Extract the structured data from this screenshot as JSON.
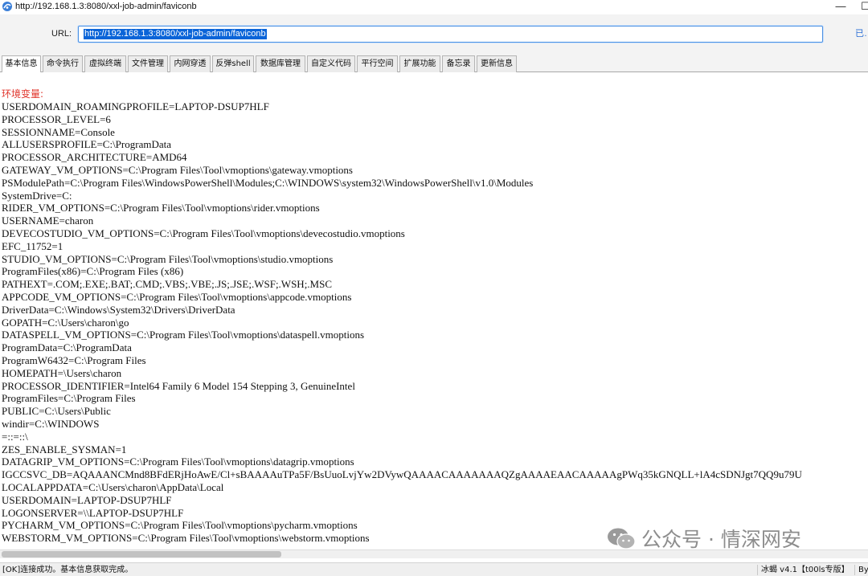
{
  "window": {
    "title": "http://192.168.1.3:8080/xxl-job-admin/faviconb",
    "minimize_glyph": "—",
    "maximize_glyph": "☐"
  },
  "urlbar": {
    "label": "URL:",
    "value": "http://192.168.1.3:8080/xxl-job-admin/faviconb",
    "right_text": "已…"
  },
  "tabs": [
    {
      "label": "基本信息",
      "active": true
    },
    {
      "label": "命令执行"
    },
    {
      "label": "虚拟终端"
    },
    {
      "label": "文件管理"
    },
    {
      "label": "内网穿透"
    },
    {
      "label": "反弹shell"
    },
    {
      "label": "数据库管理"
    },
    {
      "label": "自定义代码"
    },
    {
      "label": "平行空间"
    },
    {
      "label": "扩展功能"
    },
    {
      "label": "备忘录"
    },
    {
      "label": "更新信息"
    }
  ],
  "content": {
    "header": "环境变量:",
    "lines": [
      "USERDOMAIN_ROAMINGPROFILE=LAPTOP-DSUP7HLF",
      "PROCESSOR_LEVEL=6",
      "SESSIONNAME=Console",
      "ALLUSERSPROFILE=C:\\ProgramData",
      "PROCESSOR_ARCHITECTURE=AMD64",
      "GATEWAY_VM_OPTIONS=C:\\Program Files\\Tool\\vmoptions\\gateway.vmoptions",
      "PSModulePath=C:\\Program Files\\WindowsPowerShell\\Modules;C:\\WINDOWS\\system32\\WindowsPowerShell\\v1.0\\Modules",
      "SystemDrive=C:",
      "RIDER_VM_OPTIONS=C:\\Program Files\\Tool\\vmoptions\\rider.vmoptions",
      "USERNAME=charon",
      "DEVECOSTUDIO_VM_OPTIONS=C:\\Program Files\\Tool\\vmoptions\\devecostudio.vmoptions",
      "EFC_11752=1",
      "STUDIO_VM_OPTIONS=C:\\Program Files\\Tool\\vmoptions\\studio.vmoptions",
      "ProgramFiles(x86)=C:\\Program Files (x86)",
      "PATHEXT=.COM;.EXE;.BAT;.CMD;.VBS;.VBE;.JS;.JSE;.WSF;.WSH;.MSC",
      "APPCODE_VM_OPTIONS=C:\\Program Files\\Tool\\vmoptions\\appcode.vmoptions",
      "DriverData=C:\\Windows\\System32\\Drivers\\DriverData",
      "GOPATH=C:\\Users\\charon\\go",
      "DATASPELL_VM_OPTIONS=C:\\Program Files\\Tool\\vmoptions\\dataspell.vmoptions",
      "ProgramData=C:\\ProgramData",
      "ProgramW6432=C:\\Program Files",
      "HOMEPATH=\\Users\\charon",
      "PROCESSOR_IDENTIFIER=Intel64 Family 6 Model 154 Stepping 3, GenuineIntel",
      "ProgramFiles=C:\\Program Files",
      "PUBLIC=C:\\Users\\Public",
      "windir=C:\\WINDOWS",
      "=::=::\\",
      "ZES_ENABLE_SYSMAN=1",
      "DATAGRIP_VM_OPTIONS=C:\\Program Files\\Tool\\vmoptions\\datagrip.vmoptions",
      "IGCCSVC_DB=AQAAANCMnd8BFdERjHoAwE/Cl+sBAAAAuTPa5F/BsUuoLvjYw2DVywQAAAACAAAAAAAQZgAAAAEAACAAAAAgPWq35kGNQLL+lA4cSDNJgt7QQ9u79U",
      "LOCALAPPDATA=C:\\Users\\charon\\AppData\\Local",
      "USERDOMAIN=LAPTOP-DSUP7HLF",
      "LOGONSERVER=\\\\LAPTOP-DSUP7HLF",
      "PYCHARM_VM_OPTIONS=C:\\Program Files\\Tool\\vmoptions\\pycharm.vmoptions",
      "WEBSTORM_VM_OPTIONS=C:\\Program Files\\Tool\\vmoptions\\webstorm.vmoptions"
    ]
  },
  "status": {
    "left": "[OK]连接成功。基本信息获取完成。",
    "version": "冰蝎 v4.1【t00ls专版】",
    "extra": "By"
  },
  "watermark": {
    "text": "公众号 · 情深网安",
    "icon": "wechat-icon"
  },
  "colors": {
    "accent": "#0a64d8",
    "header_red": "#e0342b"
  }
}
